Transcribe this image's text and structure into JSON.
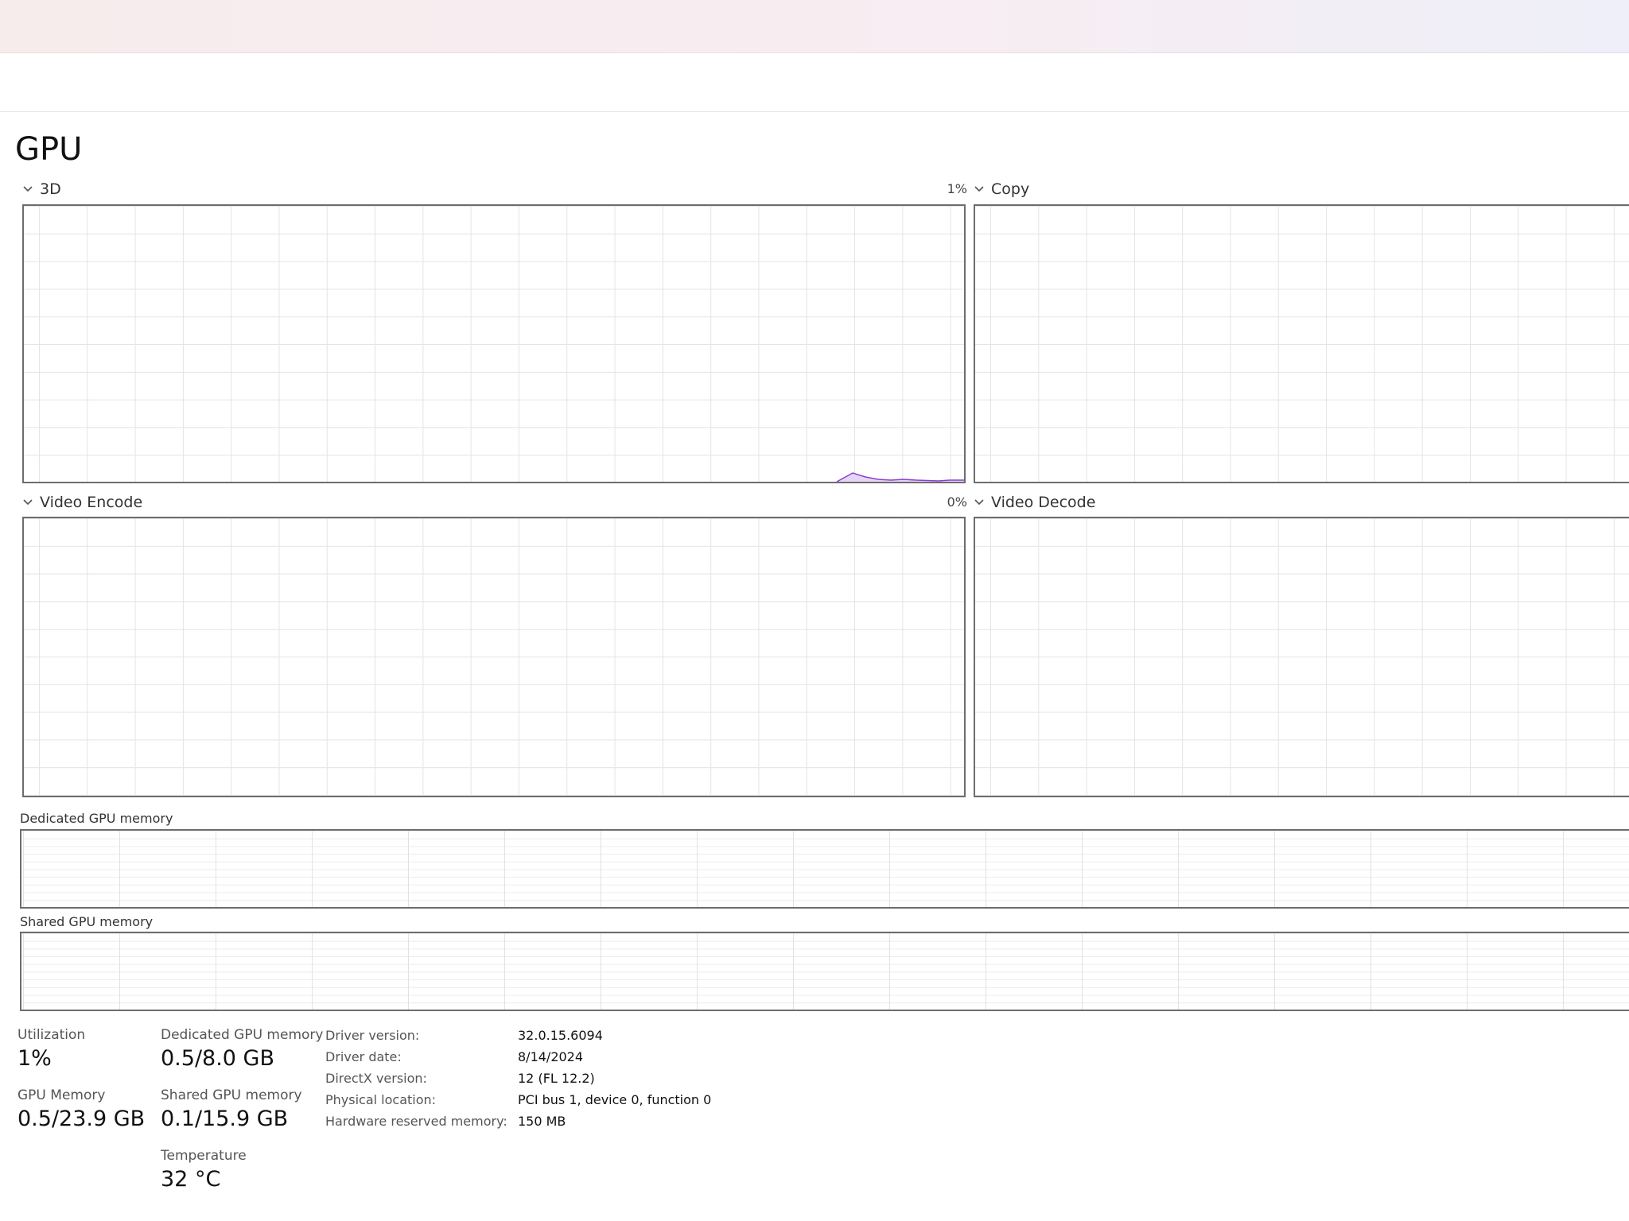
{
  "page": {
    "title": "GPU"
  },
  "engines": [
    {
      "name": "3D",
      "percent": "1%"
    },
    {
      "name": "Copy",
      "percent": ""
    },
    {
      "name": "Video Encode",
      "percent": "0%"
    },
    {
      "name": "Video Decode",
      "percent": ""
    }
  ],
  "memory_graphs": {
    "dedicated_label": "Dedicated GPU memory",
    "shared_label": "Shared GPU memory"
  },
  "stats": {
    "utilization_label": "Utilization",
    "utilization_value": "1%",
    "gpu_memory_label": "GPU Memory",
    "gpu_memory_value": "0.5/23.9 GB",
    "dedicated_label": "Dedicated GPU memory",
    "dedicated_value": "0.5/8.0 GB",
    "shared_label": "Shared GPU memory",
    "shared_value": "0.1/15.9 GB",
    "temperature_label": "Temperature",
    "temperature_value": "32 °C"
  },
  "properties": [
    {
      "key": "Driver version:",
      "value": "32.0.15.6094"
    },
    {
      "key": "Driver date:",
      "value": "8/14/2024"
    },
    {
      "key": "DirectX version:",
      "value": "12 (FL 12.2)"
    },
    {
      "key": "Physical location:",
      "value": "PCI bus 1, device 0, function 0"
    },
    {
      "key": "Hardware reserved memory:",
      "value": "150 MB"
    }
  ],
  "colors": {
    "accent": "#8a3fd1",
    "accent_fill": "#e6d6f5"
  }
}
